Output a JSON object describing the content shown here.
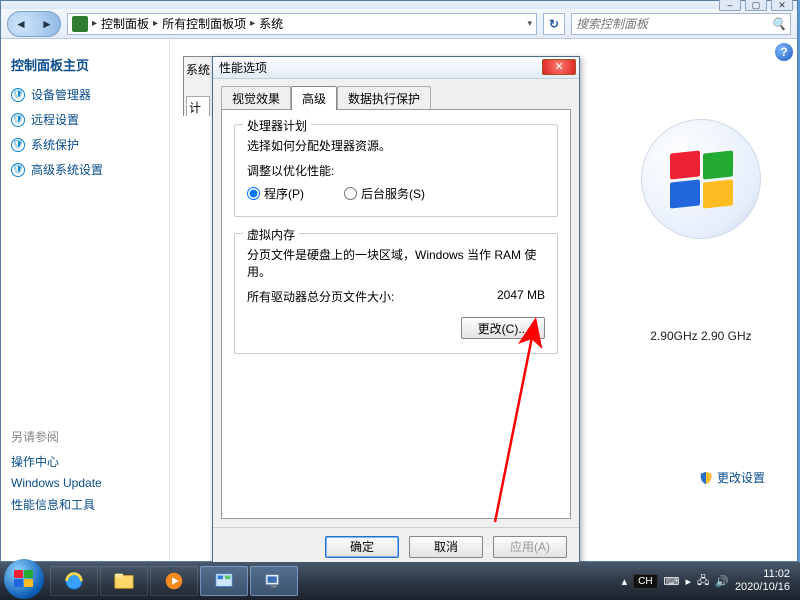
{
  "breadcrumb": {
    "level1": "控制面板",
    "level2": "所有控制面板项",
    "level3": "系统"
  },
  "search": {
    "placeholder": "搜索控制面板"
  },
  "left_nav": {
    "title": "控制面板主页",
    "items": [
      "设备管理器",
      "远程设置",
      "系统保护",
      "高级系统设置"
    ],
    "see_also_title": "另请参阅",
    "see_also": [
      "操作中心",
      "Windows Update",
      "性能信息和工具"
    ]
  },
  "main": {
    "cpu_line": "2.90GHz  2.90 GHz",
    "change_settings": "更改设置"
  },
  "sys_props_stub": {
    "title": "系统",
    "tab": "计"
  },
  "perf": {
    "title": "性能选项",
    "tabs": [
      "视觉效果",
      "高级",
      "数据执行保护"
    ],
    "active_tab_index": 1,
    "cpu_group": {
      "title": "处理器计划",
      "desc": "选择如何分配处理器资源。",
      "adjust_label": "调整以优化性能:",
      "radios": {
        "programs": "程序(P)",
        "background": "后台服务(S)"
      },
      "selected": "programs"
    },
    "vm_group": {
      "title": "虚拟内存",
      "desc": "分页文件是硬盘上的一块区域，Windows 当作 RAM 使用。",
      "total_label": "所有驱动器总分页文件大小:",
      "total_value": "2047 MB",
      "change_btn": "更改(C)..."
    },
    "buttons": {
      "ok": "确定",
      "cancel": "取消",
      "apply": "应用(A)"
    }
  },
  "taskbar": {
    "lang": "CH",
    "time": "11:02",
    "date": "2020/10/16"
  }
}
